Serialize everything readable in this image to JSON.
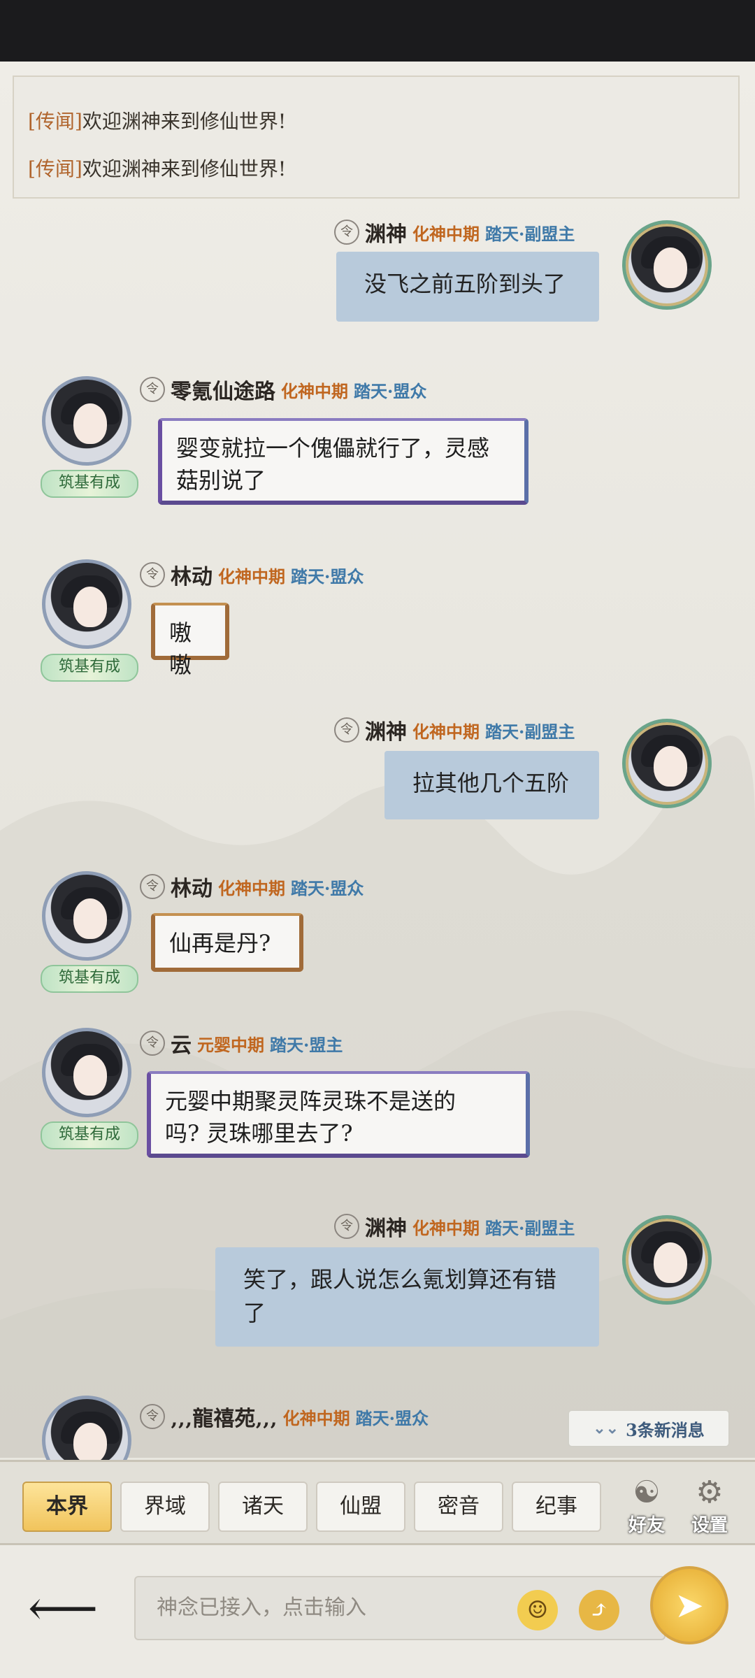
{
  "news": [
    {
      "tag": "[传闻]",
      "text": "欢迎渊神来到修仙世界!"
    },
    {
      "tag": "[传闻]",
      "text": "欢迎渊神来到修仙世界!"
    }
  ],
  "messages": [
    {
      "nick": "渊神",
      "realm": "化神中期",
      "guild": "踏天·副盟主",
      "text": "没飞之前五阶到头了"
    },
    {
      "nick": "零氪仙途路",
      "realm": "化神中期",
      "guild": "踏天·盟众",
      "rank": "筑基有成",
      "text_line1": "婴变就拉一个傀儡就行了，灵感",
      "text_line2": "菇别说了"
    },
    {
      "nick": "林动",
      "realm": "化神中期",
      "guild": "踏天·盟众",
      "rank": "筑基有成",
      "text": "嗷嗷"
    },
    {
      "nick": "渊神",
      "realm": "化神中期",
      "guild": "踏天·副盟主",
      "text": "拉其他几个五阶"
    },
    {
      "nick": "林动",
      "realm": "化神中期",
      "guild": "踏天·盟众",
      "rank": "筑基有成",
      "text": "仙再是丹?"
    },
    {
      "nick": "云",
      "realm": "元婴中期",
      "guild": "踏天·盟主",
      "rank": "筑基有成",
      "text_line1": "元婴中期聚灵阵灵珠不是送的",
      "text_line2": "吗? 灵珠哪里去了?"
    },
    {
      "nick": "渊神",
      "realm": "化神中期",
      "guild": "踏天·副盟主",
      "text_line1": "笑了，跟人说怎么氪划算还有错",
      "text_line2": "了"
    },
    {
      "nick": "‚‚‚龍禧苑‚‚‚",
      "realm": "化神中期",
      "guild": "踏天·盟众"
    }
  ],
  "new_messages": "3条新消息",
  "tabs": [
    "本界",
    "界域",
    "诸天",
    "仙盟",
    "密音",
    "纪事"
  ],
  "side": {
    "friends": "好友",
    "settings": "设置"
  },
  "input": {
    "placeholder": "神念已接入，点击输入"
  },
  "colors": {
    "accent": "#f1c45c",
    "bubble_self": "#b8cadb",
    "realm": "#c0661f",
    "guild": "#3f79a8"
  }
}
